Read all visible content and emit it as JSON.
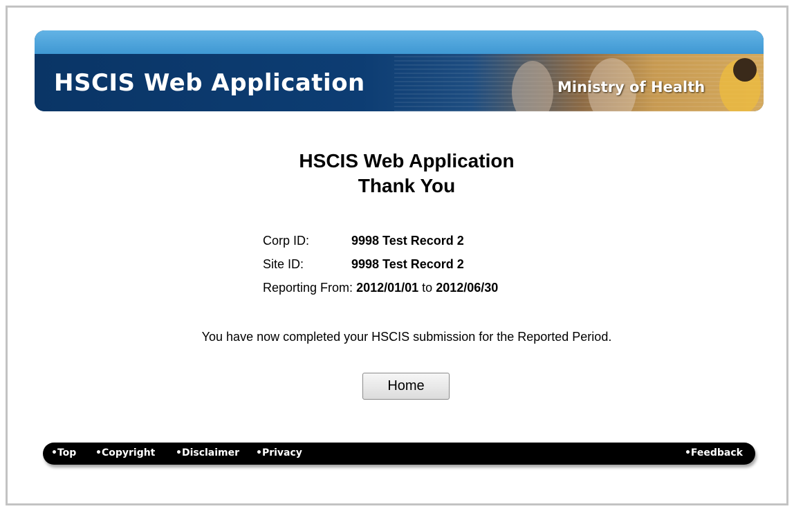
{
  "banner": {
    "title": "HSCIS Web Application",
    "ministry": "Ministry of Health"
  },
  "main": {
    "heading_line1": "HSCIS Web Application",
    "heading_line2": "Thank You",
    "info": {
      "corp_label": "Corp ID:",
      "corp_value": "9998 Test Record 2",
      "site_label": "Site ID:",
      "site_value": "9998 Test Record 2",
      "reporting_label": "Reporting From:",
      "reporting_from": "2012/01/01",
      "reporting_to_word": "to",
      "reporting_to": "2012/06/30"
    },
    "message": "You have now completed your HSCIS submission for the Reported Period.",
    "home_button": "Home"
  },
  "footer": {
    "links": [
      "•Top",
      "•Copyright",
      "•Disclaimer",
      "•Privacy"
    ],
    "feedback": "•Feedback"
  }
}
